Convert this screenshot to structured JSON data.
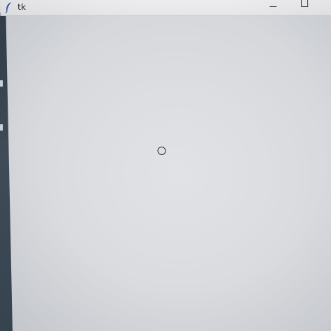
{
  "window": {
    "title": "tk",
    "icon": "feather-icon",
    "controls": [
      "minimize-icon",
      "maximize-icon"
    ]
  },
  "canvas": {
    "content": "empty",
    "marker_icon": "cursor-ring-icon"
  },
  "colors": {
    "titlebar": "#e8e8ea",
    "client_background": "#dcdee1",
    "desktop_backdrop": "#36424d",
    "feather": "#2f4fa3"
  }
}
